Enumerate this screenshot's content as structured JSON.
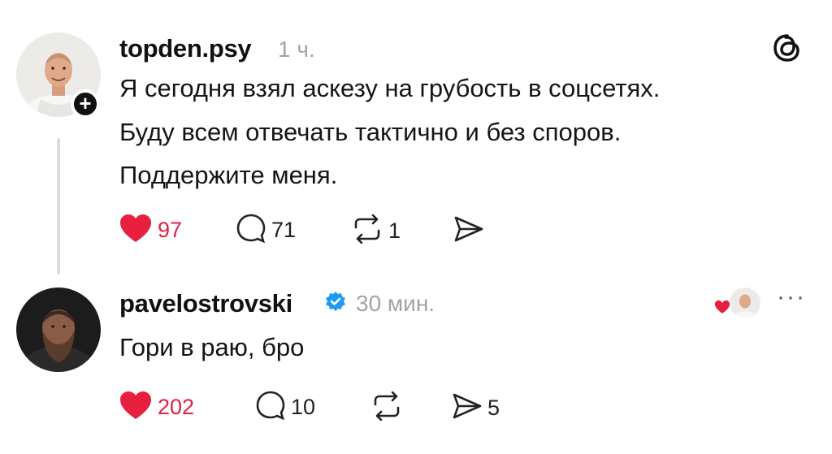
{
  "post": {
    "username": "topden.psy",
    "time": "1 ч.",
    "lines": [
      "Я сегодня взял аскезу на грубость в соцсетях.",
      "Буду всем отвечать тактично и без споров.",
      "Поддержите меня."
    ],
    "likes": "97",
    "comments": "71",
    "reposts": "1",
    "shares": ""
  },
  "reply": {
    "username": "pavelostrovski",
    "time": "30 мин.",
    "text": "Гори в раю, бро",
    "likes": "202",
    "comments": "10",
    "reposts": "",
    "shares": "5"
  },
  "colors": {
    "like": "#e8203f",
    "verified": "#1d9bf0",
    "muted": "#a3a3a3"
  },
  "icons": {
    "app": "threads-icon",
    "like": "heart-icon",
    "comment": "comment-icon",
    "repost": "repost-icon",
    "share": "share-icon",
    "more": "more-icon",
    "verified": "verified-badge-icon",
    "follow": "plus-icon"
  }
}
